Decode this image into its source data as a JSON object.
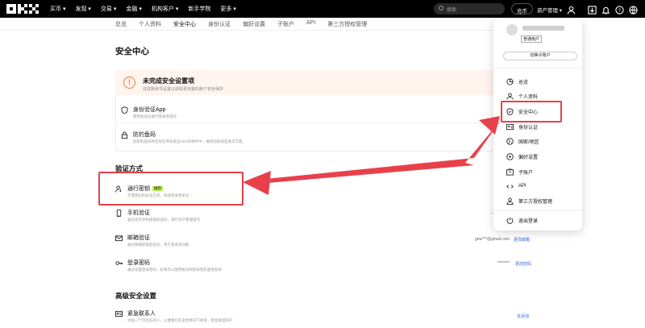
{
  "topbar": {
    "nav": [
      "买币 ▾",
      "发现 ▾",
      "交易 ▾",
      "金融 ▾",
      "机构客户 ▾",
      "新手学院",
      "更多 ▾"
    ],
    "search_placeholder": "搜索",
    "currency_btn": "充币",
    "assets_btn": "资产管理 ▾"
  },
  "tabs": [
    "总览",
    "个人资料",
    "安全中心",
    "身份认证",
    "偏好设置",
    "子账户",
    "API",
    "第三方授权管理"
  ],
  "page": {
    "title": "安全中心",
    "warning_title": "未完成安全设置项",
    "warning_desc": "完成剩余项设置以获取更完整的账户安全保护",
    "items": [
      {
        "title": "身份验证App",
        "desc": "使用验证码进行登录等操作"
      },
      {
        "title": "防钓鱼码",
        "desc": "此防钓鱼码将出现在所有来自OKX的邮件中，确保您知道是真实可靠。"
      }
    ],
    "verify_heading": "验证方式",
    "passkey": {
      "title": "通行密钥",
      "badge": "推荐",
      "desc": "无需密码的验证方式，快速登录更安全"
    },
    "verify_items": [
      {
        "title": "手机验证",
        "desc": "通过您的手机接收验证码，进行资产管理操作",
        "value": "",
        "link": ""
      },
      {
        "title": "邮箱验证",
        "desc": "通过邮箱获取验证码，用于登录等功能",
        "value": "gew***@gmail.com",
        "link": "更改邮箱"
      },
      {
        "title": "登录密码",
        "desc": "通过设置登录密码，您将可以使用账号和登录密码直接登录",
        "value": "********",
        "link": "更改密码"
      }
    ],
    "advanced_heading": "高级安全设置",
    "advanced_items": [
      {
        "title": "紧急联系人",
        "desc": "添加一个可信任的人，以便我们在紧急情况下联系，帮您管理资产",
        "link": "去添加"
      }
    ]
  },
  "menu": {
    "user_tag": "普通用户",
    "switch_label": "切换子账户",
    "items": [
      "总览",
      "个人资料",
      "安全中心",
      "身份认证",
      "国家/地区",
      "偏好设置",
      "子账户",
      "API",
      "第三方授权管理",
      "退出登录"
    ]
  },
  "colors": {
    "accent_red": "#e8404a",
    "warning_orange": "#f07a2c",
    "badge_green": "#b8f34a",
    "link_blue": "#2f6be0"
  }
}
